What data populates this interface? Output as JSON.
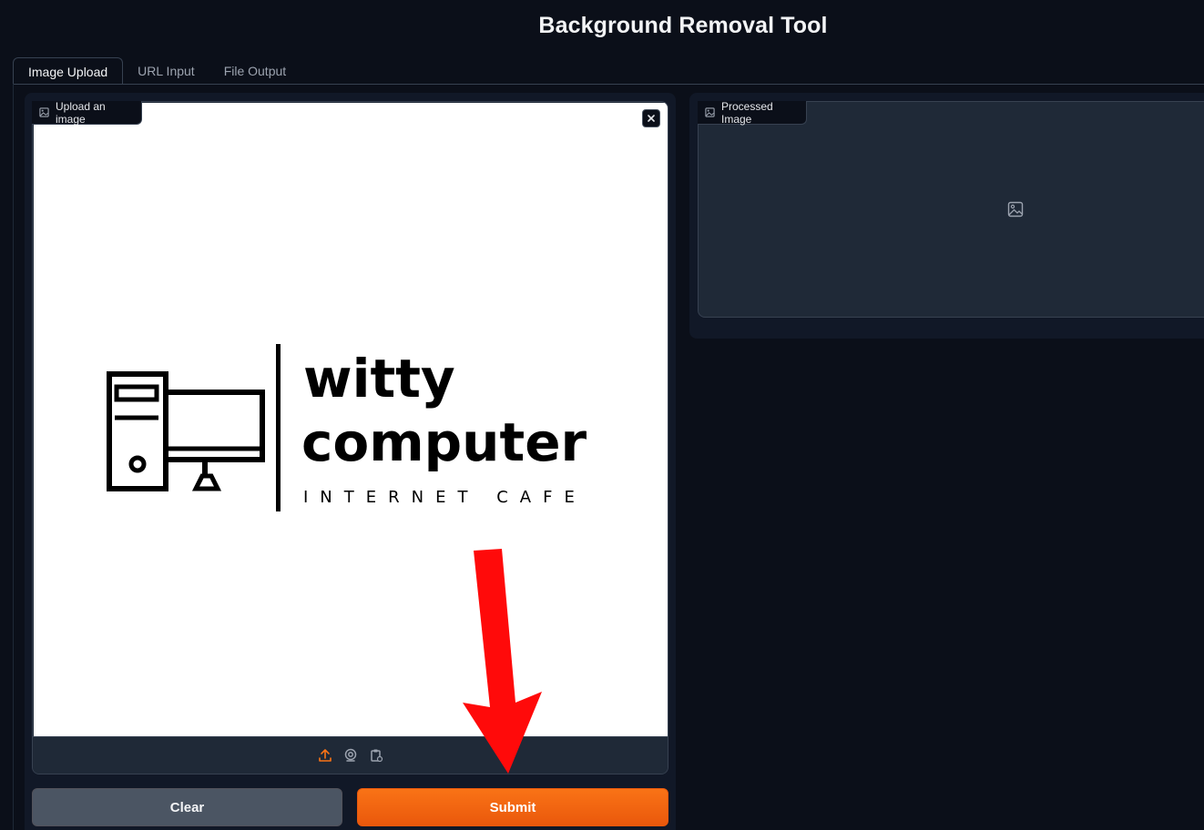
{
  "app": {
    "title": "Background Removal Tool"
  },
  "tabs": [
    {
      "label": "Image Upload",
      "active": true
    },
    {
      "label": "URL Input",
      "active": false
    },
    {
      "label": "File Output",
      "active": false
    }
  ],
  "input_panel": {
    "label": "Upload an image",
    "image_content": {
      "line1": "witty",
      "line2": "computer",
      "line3": "INTERNET CAFE"
    },
    "toolbar_icons": [
      "upload-icon",
      "webcam-icon",
      "clipboard-icon"
    ]
  },
  "output_panel": {
    "label": "Processed Image"
  },
  "buttons": {
    "clear": "Clear",
    "submit": "Submit"
  },
  "colors": {
    "accent": "#f97316",
    "background": "#0b0f19",
    "annotation_arrow": "#ff0000"
  }
}
